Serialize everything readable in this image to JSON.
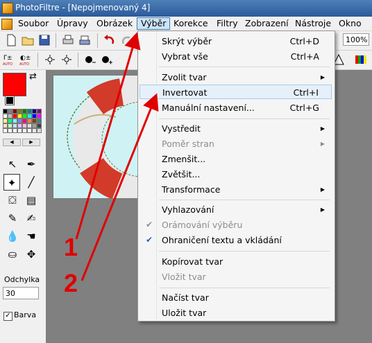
{
  "window": {
    "title": "PhotoFiltre - [Nepojmenovaný 4]"
  },
  "menubar": {
    "items": [
      "Soubor",
      "Úpravy",
      "Obrázek",
      "Výběr",
      "Korekce",
      "Filtry",
      "Zobrazení",
      "Nástroje",
      "Okno"
    ],
    "active": "Výběr"
  },
  "toolbar": {
    "zoom_value": "100%"
  },
  "left_panel": {
    "foreground_color": "#ff0000",
    "background_color": "#000000",
    "tolerance_label": "Odchylka",
    "tolerance_value": "30",
    "color_checkbox_label": "Barva",
    "color_checkbox_checked": true
  },
  "dropdown": {
    "groups": [
      [
        {
          "label": "Skrýt výběr",
          "shortcut": "Ctrl+D"
        },
        {
          "label": "Vybrat vše",
          "shortcut": "Ctrl+A"
        }
      ],
      [
        {
          "label": "Zvolit tvar",
          "submenu": true
        },
        {
          "label": "Invertovat",
          "shortcut": "Ctrl+I",
          "highlighted": true
        },
        {
          "label": "Manuální nastavení...",
          "shortcut": "Ctrl+G"
        }
      ],
      [
        {
          "label": "Vystředit",
          "submenu": true
        },
        {
          "label": "Poměr stran",
          "submenu": true,
          "disabled": true
        },
        {
          "label": "Zmenšit..."
        },
        {
          "label": "Zvětšit..."
        },
        {
          "label": "Transformace",
          "submenu": true
        }
      ],
      [
        {
          "label": "Vyhlazování",
          "submenu": true
        },
        {
          "label": "Orámování výběru",
          "checked": true,
          "disabled": true
        },
        {
          "label": "Ohraničení textu a vkládání",
          "checked": true
        }
      ],
      [
        {
          "label": "Kopírovat tvar"
        },
        {
          "label": "Vložit tvar",
          "disabled": true
        }
      ],
      [
        {
          "label": "Načíst tvar"
        },
        {
          "label": "Uložit tvar"
        }
      ]
    ]
  },
  "annotations": {
    "step1": "1",
    "step2": "2",
    "color": "#e00000"
  }
}
